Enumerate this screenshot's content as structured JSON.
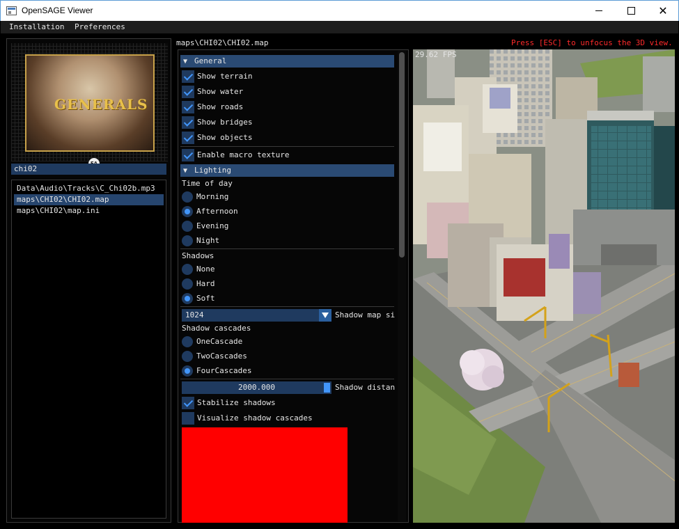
{
  "window": {
    "title": "OpenSAGE Viewer",
    "minimize_icon": "minimize-icon",
    "maximize_icon": "maximize-icon",
    "close_icon": "close-icon",
    "close_glyph": "✕"
  },
  "menu": {
    "items": [
      "Installation",
      "Preferences"
    ]
  },
  "left": {
    "art_title": "GENERALS",
    "art_badge": "EA",
    "search_value": "chi02",
    "files": [
      "Data\\Audio\\Tracks\\C_Chi02b.mp3",
      "maps\\CHI02\\CHI02.map",
      "maps\\CHI02\\map.ini"
    ],
    "selected_index": 1
  },
  "middle": {
    "path": "maps\\CHI02\\CHI02.map",
    "general_header": "General",
    "show_terrain": "Show terrain",
    "show_water": "Show water",
    "show_roads": "Show roads",
    "show_bridges": "Show bridges",
    "show_objects": "Show objects",
    "enable_macro": "Enable macro texture",
    "lighting_header": "Lighting",
    "time_of_day": "Time of day",
    "morning": "Morning",
    "afternoon": "Afternoon",
    "evening": "Evening",
    "night": "Night",
    "shadows": "Shadows",
    "none": "None",
    "hard": "Hard",
    "soft": "Soft",
    "shadow_map_value": "1024",
    "shadow_map_label": "Shadow map si",
    "shadow_cascades": "Shadow cascades",
    "one_cascade": "OneCascade",
    "two_cascades": "TwoCascades",
    "four_cascades": "FourCascades",
    "shadow_distance_value": "2000.000",
    "shadow_distance_label": "Shadow distan",
    "stabilize": "Stabilize shadows",
    "visualize": "Visualize shadow cascades",
    "expanded_arrow": "▼"
  },
  "view": {
    "esc_message": "Press [ESC] to unfocus the 3D view.",
    "fps": "29.62 FPS"
  },
  "colors": {
    "accent": "#4296fa",
    "header_bg": "#2a4a73",
    "frame_bg": "#1f3a5f",
    "esc_text": "#ff2a2a",
    "preview_box": "#ff0000"
  }
}
